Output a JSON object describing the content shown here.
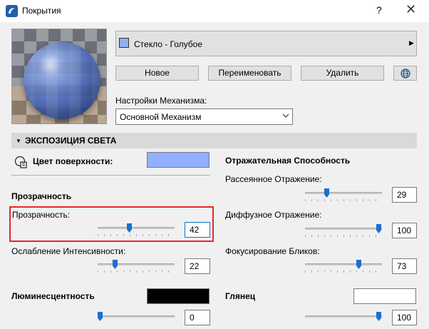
{
  "window": {
    "title": "Покрытия",
    "help": "?",
    "close": "✕"
  },
  "surface": {
    "name": "Стекло - Голубое",
    "swatch_color": "#92b0f0"
  },
  "buttons": {
    "new": "Новое",
    "rename": "Переименовать",
    "delete": "Удалить"
  },
  "engine": {
    "label": "Настройки Механизма:",
    "value": "Основной Механизм"
  },
  "section": {
    "title": "ЭКСПОЗИЦИЯ СВЕТА"
  },
  "left": {
    "surface_color_label": "Цвет поверхности:",
    "surface_color": "#92b0ff",
    "transparency_heading": "Прозрачность",
    "transparency_label": "Прозрачность:",
    "transparency_value": "42",
    "attenuation_label": "Ослабление Интенсивности:",
    "attenuation_value": "22",
    "luminance_label": "Люминесцентность",
    "luminance_color": "#000000",
    "luminance_value": "0"
  },
  "right": {
    "reflectance_heading": "Отражательная Способность",
    "diffuse_reflection_label": "Рассеянное Отражение:",
    "diffuse_reflection_value": "29",
    "diffuse_label": "Диффузное Отражение:",
    "diffuse_value": "100",
    "specular_label": "Фокусирование Бликов:",
    "specular_value": "73",
    "gloss_label": "Глянец",
    "gloss_color": "#ffffff",
    "gloss_value": "100"
  },
  "colors": {
    "accent": "#1d6fd0",
    "highlight": "#e8262a"
  }
}
